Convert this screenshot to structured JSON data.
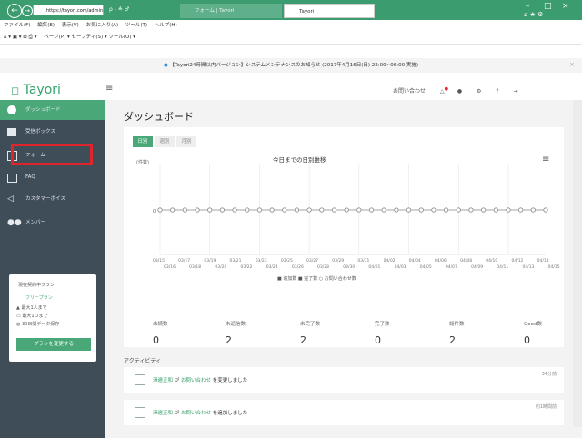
{
  "browser": {
    "address": "https://tayori.com/admin",
    "search_glyphs": "ρ - ≙ ♂",
    "tab1_title": "フォーム | Tayori",
    "tab2_title": "Tayori",
    "menu": [
      "ファイル(F)",
      "編集(E)",
      "表示(V)",
      "お気に入り(A)",
      "ツール(T)",
      "ヘルプ(H)"
    ],
    "favbar": "ページ(P) ▾  セーフティ(S) ▾  ツール(O) ▾"
  },
  "notice": "【Tayori24時間以内バージョン】システムメンテナンスのお知らせ (2017年4月16日(日) 22:00~06:00 実施)",
  "app": {
    "logo": "Tayori",
    "header_right": "お問い合わせ"
  },
  "sidebar": {
    "items": [
      {
        "label": "ダッシュボード"
      },
      {
        "label": "受信ボックス"
      },
      {
        "label": "フォーム"
      },
      {
        "label": "FAQ"
      },
      {
        "label": "カスタマーボイス"
      },
      {
        "label": "メンバー"
      }
    ],
    "plan": {
      "title": "現在契約中プラン",
      "name": "フリープラン",
      "line1": "最大1人まで",
      "line2": "最大1つまで",
      "line3": "30日間データ保存",
      "button": "プランを変更する"
    }
  },
  "main": {
    "page_title": "ダッシュボード",
    "period_tabs": [
      "日別",
      "週別",
      "月別"
    ],
    "chart_title": "今日までの日別推移",
    "y_unit": "(件数)",
    "legend": "■ 追加数  ■ 完了数  ○ お問い合わせ数",
    "stats": [
      {
        "label": "未読数",
        "value": "0"
      },
      {
        "label": "未返信数",
        "value": "2"
      },
      {
        "label": "未完了数",
        "value": "2"
      },
      {
        "label": "完了数",
        "value": "0"
      },
      {
        "label": "総件数",
        "value": "2"
      },
      {
        "label": "Good数",
        "value": "0"
      }
    ],
    "activity_title": "アクティビティ",
    "activities": [
      {
        "user": "澤邉正和",
        "target": "お問い合わせ",
        "action": "を変更しました",
        "time": "34分前"
      },
      {
        "user": "澤邉正和",
        "target": "お問い合わせ",
        "action": "を追加しました",
        "time": "約1時間前"
      }
    ]
  },
  "chart_data": {
    "type": "line",
    "x_top": [
      "03/15",
      "03/17",
      "03/19",
      "03/21",
      "03/23",
      "03/25",
      "03/27",
      "03/29",
      "03/31",
      "04/02",
      "04/04",
      "04/06",
      "04/08",
      "04/10",
      "04/12",
      "04/14"
    ],
    "x_bottom": [
      "03/16",
      "03/18",
      "03/20",
      "03/22",
      "03/24",
      "03/26",
      "03/28",
      "03/30",
      "04/01",
      "04/03",
      "04/05",
      "04/07",
      "04/09",
      "04/11",
      "04/13",
      "04/15"
    ],
    "series": [
      {
        "name": "お問い合わせ数",
        "values": [
          0,
          0,
          0,
          0,
          0,
          0,
          0,
          0,
          0,
          0,
          0,
          0,
          0,
          0,
          0,
          0,
          0,
          0,
          0,
          0,
          0,
          0,
          0,
          0,
          0,
          0,
          0,
          0,
          0,
          0,
          0,
          0
        ]
      }
    ],
    "ylim": [
      0,
      0
    ],
    "y_tick": "0",
    "grid": true
  }
}
